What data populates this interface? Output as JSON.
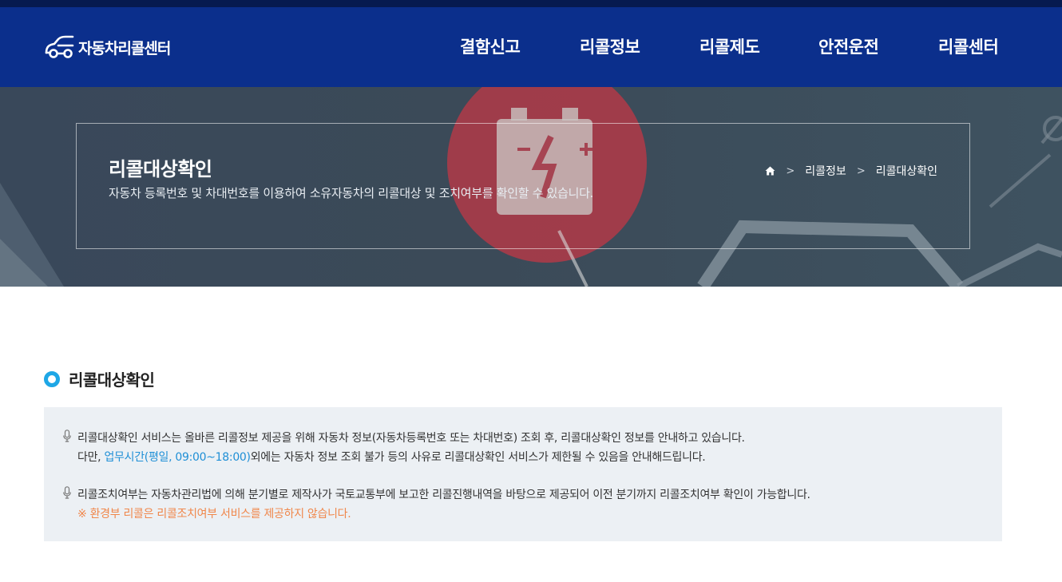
{
  "header": {
    "logo_text": "자동차리콜센터",
    "menu": [
      "결함신고",
      "리콜정보",
      "리콜제도",
      "안전운전",
      "리콜센터"
    ]
  },
  "hero": {
    "title": "리콜대상확인",
    "description": "자동차 등록번호 및 차대번호를 이용하여 소유자동차의 리콜대상 및 조치여부를 확인할 수 있습니다.",
    "breadcrumb": [
      "리콜정보",
      "리콜대상확인"
    ]
  },
  "section": {
    "title": "리콜대상확인"
  },
  "notice": {
    "item1_line1": "리콜대상확인 서비스는 올바른 리콜정보 제공을 위해 자동차 정보(자동차등록번호 또는 차대번호) 조회 후, 리콜대상확인 정보를 안내하고 있습니다.",
    "item1_line2_prefix": "다만, ",
    "item1_line2_highlight": "업무시간(평일, 09:00~18:00)",
    "item1_line2_suffix": "외에는 자동차 정보 조회 불가 등의 사유로 리콜대상확인 서비스가 제한될 수 있음을 안내해드립니다.",
    "item2_line1": "리콜조치여부는 자동차관리법에 의해 분기별로 제작사가 국토교통부에 보고한 리콜진행내역을 바탕으로 제공되어 이전 분기까지 리콜조치여부 확인이 가능합니다.",
    "item2_note": "※ 환경부 리콜은 리콜조치여부 서비스를 제공하지 않습니다."
  },
  "colors": {
    "header_bg": "#0b2f8c",
    "top_strip": "#061a4f",
    "accent_blue": "#1ea7e6",
    "highlight_blue": "#1f8fd6",
    "highlight_orange": "#f0874b",
    "notice_bg": "#ecf0f4"
  },
  "icons": {
    "logo": "car-logo-icon",
    "home": "home-icon",
    "separator": "chevron-right-icon",
    "notice_bullet": "microphone-icon"
  }
}
